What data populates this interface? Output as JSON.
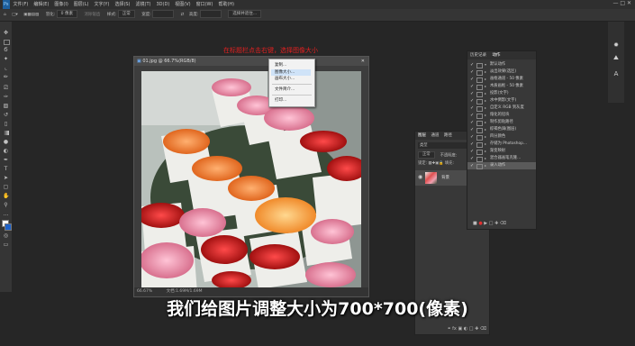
{
  "menubar": {
    "items": [
      "文件(F)",
      "编辑(E)",
      "图像(I)",
      "图层(L)",
      "文字(Y)",
      "选择(S)",
      "滤镜(T)",
      "3D(D)",
      "视图(V)",
      "窗口(W)",
      "帮助(H)"
    ]
  },
  "options": {
    "feather_label": "羽化:",
    "feather_value": "0 像素",
    "antialias": "消除锯齿",
    "style_label": "样式:",
    "style_value": "正常",
    "width_label": "宽度:",
    "height_label": "高度:",
    "select_mask": "选择并遮住..."
  },
  "annotation": {
    "text": "在标题栏点击右键，选择图像大小"
  },
  "document": {
    "title": "01.jpg @ 66.7%(RGB/8)",
    "zoom": "66.67%",
    "doc_info": "文档:1.69M/1.69M"
  },
  "context_menu": {
    "items": [
      "复制...",
      "图像大小...",
      "画布大小...",
      "文件简介...",
      "打印..."
    ]
  },
  "layers_panel": {
    "tabs": [
      "图层",
      "通道",
      "路径"
    ],
    "kind_label": "类型",
    "mode_label": "正常",
    "opacity_label": "不透明度:",
    "lock_label": "锁定:",
    "fill_label": "填充:",
    "layer_name": "背景"
  },
  "history_panel": {
    "tabs": [
      "历史记录",
      "动作"
    ],
    "rows": [
      "默认动作",
      "淡出效果(选区)",
      "画框通道 - 50 像素",
      "木质画框 - 50 像素",
      "投影(文字)",
      "水中倒影(文字)",
      "自定义 RGB 到灰度",
      "熔化的铅块",
      "制作剪贴路径",
      "棕褐色调(图层)",
      "四分颜色",
      "存储为 Photoshop...",
      "渐变映射",
      "混合器画笔克隆...",
      "录入动作"
    ]
  },
  "subtitle": {
    "text": "我们给图片调整大小为700*700(像素)"
  },
  "icons": {
    "toolbox": [
      "move-icon",
      "marquee-icon",
      "lasso-icon",
      "magic-wand-icon",
      "crop-icon",
      "eyedropper-icon",
      "healing-icon",
      "brush-icon",
      "stamp-icon",
      "history-brush-icon",
      "eraser-icon",
      "gradient-icon",
      "blur-icon",
      "dodge-icon",
      "pen-icon",
      "type-icon",
      "path-select-icon",
      "shape-icon",
      "hand-icon",
      "zoom-icon"
    ]
  },
  "colors": {
    "accent_red": "#e02020",
    "bg": "#262626",
    "panel": "#383838"
  }
}
